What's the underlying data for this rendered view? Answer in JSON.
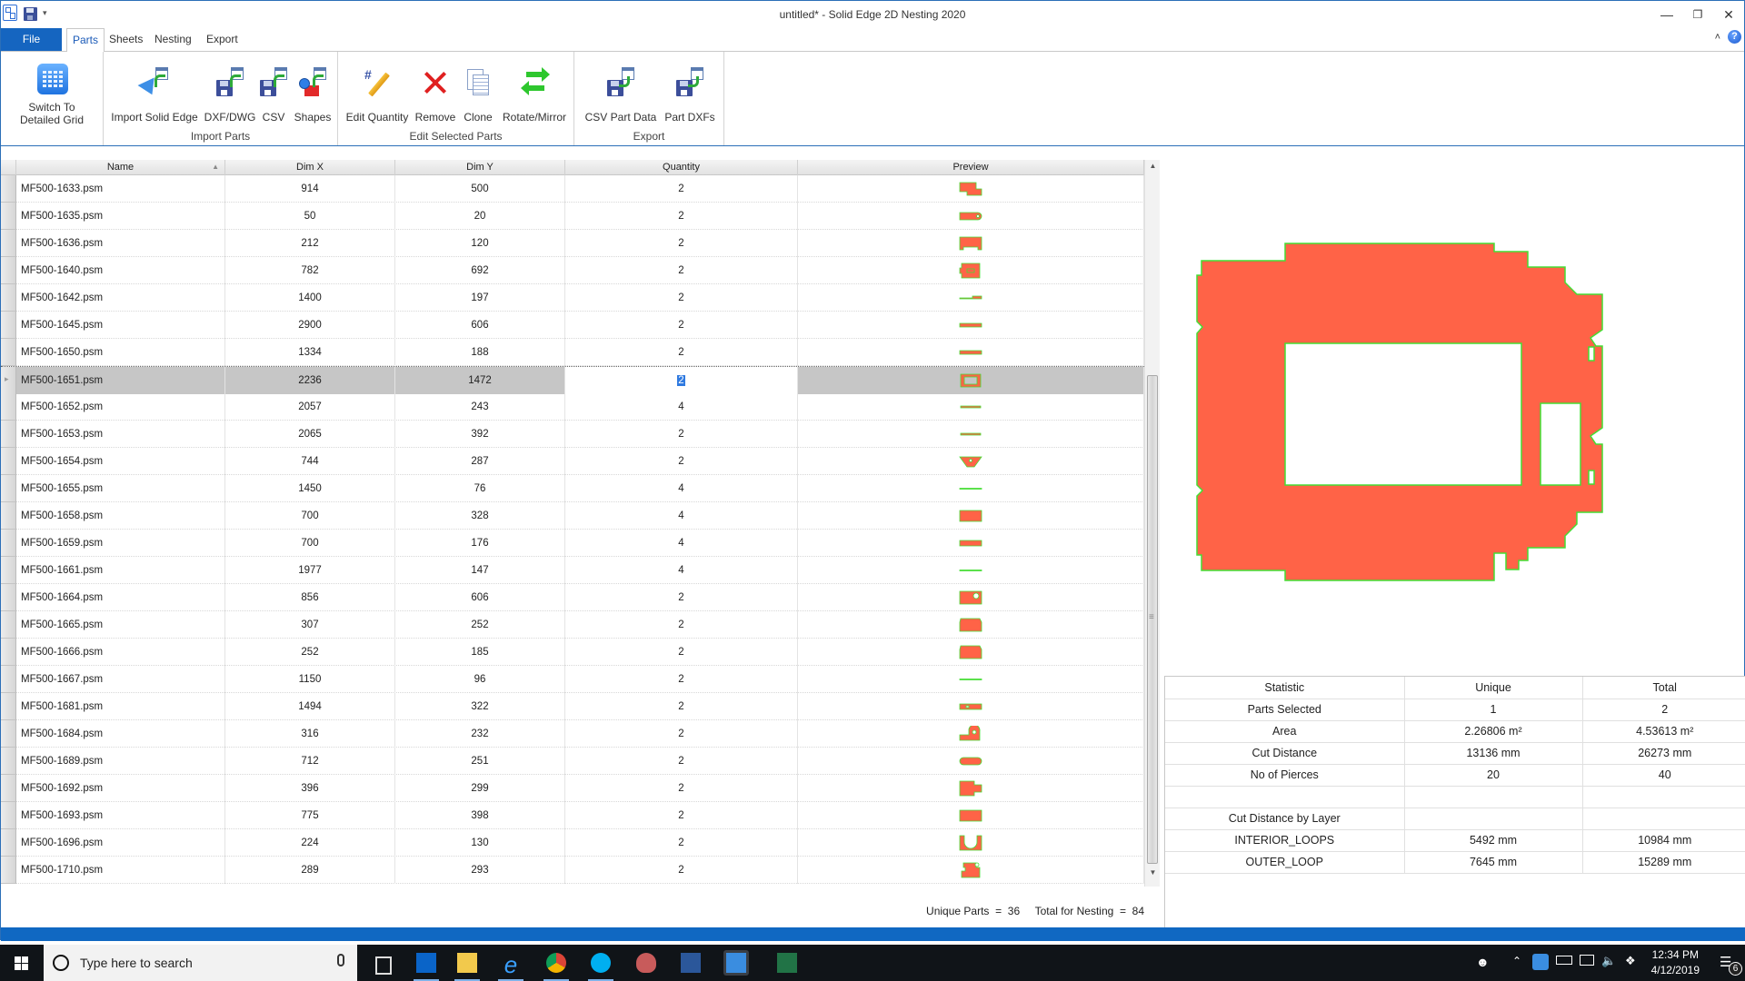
{
  "window": {
    "title": "untitled* - Solid Edge 2D Nesting 2020",
    "quick_access_dropdown": "▾",
    "controls": {
      "minimize": "—",
      "restore": "❐",
      "close": "✕"
    }
  },
  "ribbon": {
    "file_tab": "File",
    "tabs": [
      {
        "label": "Parts",
        "active": true
      },
      {
        "label": "Sheets",
        "active": false
      },
      {
        "label": "Nesting",
        "active": false
      },
      {
        "label": "Export",
        "active": false
      }
    ],
    "collapse_glyph": "˄",
    "help_glyph": "?",
    "groups": [
      {
        "label": "",
        "buttons": [
          {
            "label": "Switch To Detailed Grid",
            "icon": "grid-icon"
          }
        ]
      },
      {
        "label": "Import Parts",
        "buttons": [
          {
            "label": "Import Solid Edge",
            "icon": "import-solid-edge-icon"
          },
          {
            "label": "DXF/DWG",
            "icon": "import-dxf-icon"
          },
          {
            "label": "CSV",
            "icon": "import-csv-icon"
          },
          {
            "label": "Shapes",
            "icon": "shapes-icon"
          }
        ]
      },
      {
        "label": "Edit Selected Parts",
        "buttons": [
          {
            "label": "Edit Quantity",
            "icon": "edit-quantity-icon"
          },
          {
            "label": "Remove",
            "icon": "remove-icon"
          },
          {
            "label": "Clone",
            "icon": "clone-icon"
          },
          {
            "label": "Rotate/Mirror",
            "icon": "rotate-mirror-icon"
          }
        ]
      },
      {
        "label": "Export",
        "buttons": [
          {
            "label": "CSV Part Data",
            "icon": "export-csv-icon"
          },
          {
            "label": "Part DXFs",
            "icon": "export-dxf-icon"
          }
        ]
      }
    ]
  },
  "grid": {
    "columns": {
      "name": "Name",
      "dim_x": "Dim X",
      "dim_y": "Dim Y",
      "quantity": "Quantity",
      "preview": "Preview"
    },
    "sort_glyph": "▲",
    "selected_index": 7,
    "rows": [
      {
        "name": "MF500-1633.psm",
        "dim_x": "914",
        "dim_y": "500",
        "quantity": "2",
        "preview": "bracket-shape"
      },
      {
        "name": "MF500-1635.psm",
        "dim_x": "50",
        "dim_y": "20",
        "quantity": "2",
        "preview": "tab-hole-shape"
      },
      {
        "name": "MF500-1636.psm",
        "dim_x": "212",
        "dim_y": "120",
        "quantity": "2",
        "preview": "notched-rect-shape"
      },
      {
        "name": "MF500-1640.psm",
        "dim_x": "782",
        "dim_y": "692",
        "quantity": "2",
        "preview": "complex-panel-shape"
      },
      {
        "name": "MF500-1642.psm",
        "dim_x": "1400",
        "dim_y": "197",
        "quantity": "2",
        "preview": "thin-step-strip-shape"
      },
      {
        "name": "MF500-1645.psm",
        "dim_x": "2900",
        "dim_y": "606",
        "quantity": "2",
        "preview": "strip-shape"
      },
      {
        "name": "MF500-1650.psm",
        "dim_x": "1334",
        "dim_y": "188",
        "quantity": "2",
        "preview": "strip-shape"
      },
      {
        "name": "MF500-1651.psm",
        "dim_x": "2236",
        "dim_y": "1472",
        "quantity": "2",
        "preview": "frame-shape"
      },
      {
        "name": "MF500-1652.psm",
        "dim_x": "2057",
        "dim_y": "243",
        "quantity": "4",
        "preview": "thin-strip-shape"
      },
      {
        "name": "MF500-1653.psm",
        "dim_x": "2065",
        "dim_y": "392",
        "quantity": "2",
        "preview": "thin-strip-shape"
      },
      {
        "name": "MF500-1654.psm",
        "dim_x": "744",
        "dim_y": "287",
        "quantity": "2",
        "preview": "trapezoid-shape"
      },
      {
        "name": "MF500-1655.psm",
        "dim_x": "1450",
        "dim_y": "76",
        "quantity": "4",
        "preview": "line-shape"
      },
      {
        "name": "MF500-1658.psm",
        "dim_x": "700",
        "dim_y": "328",
        "quantity": "4",
        "preview": "rect-shape"
      },
      {
        "name": "MF500-1659.psm",
        "dim_x": "700",
        "dim_y": "176",
        "quantity": "4",
        "preview": "flat-rect-shape"
      },
      {
        "name": "MF500-1661.psm",
        "dim_x": "1977",
        "dim_y": "147",
        "quantity": "4",
        "preview": "line-shape"
      },
      {
        "name": "MF500-1664.psm",
        "dim_x": "856",
        "dim_y": "606",
        "quantity": "2",
        "preview": "rect-hole-shape"
      },
      {
        "name": "MF500-1665.psm",
        "dim_x": "307",
        "dim_y": "252",
        "quantity": "2",
        "preview": "block-shape"
      },
      {
        "name": "MF500-1666.psm",
        "dim_x": "252",
        "dim_y": "185",
        "quantity": "2",
        "preview": "block-shape"
      },
      {
        "name": "MF500-1667.psm",
        "dim_x": "1150",
        "dim_y": "96",
        "quantity": "2",
        "preview": "line-shape"
      },
      {
        "name": "MF500-1681.psm",
        "dim_x": "1494",
        "dim_y": "322",
        "quantity": "2",
        "preview": "slotted-strip-shape"
      },
      {
        "name": "MF500-1684.psm",
        "dim_x": "316",
        "dim_y": "232",
        "quantity": "2",
        "preview": "lug-shape"
      },
      {
        "name": "MF500-1689.psm",
        "dim_x": "712",
        "dim_y": "251",
        "quantity": "2",
        "preview": "rounded-strip-shape"
      },
      {
        "name": "MF500-1692.psm",
        "dim_x": "396",
        "dim_y": "299",
        "quantity": "2",
        "preview": "notched-block-shape"
      },
      {
        "name": "MF500-1693.psm",
        "dim_x": "775",
        "dim_y": "398",
        "quantity": "2",
        "preview": "rect-shape"
      },
      {
        "name": "MF500-1696.psm",
        "dim_x": "224",
        "dim_y": "130",
        "quantity": "2",
        "preview": "u-shape"
      },
      {
        "name": "MF500-1710.psm",
        "dim_x": "289",
        "dim_y": "293",
        "quantity": "2",
        "preview": "bracket-hole-shape"
      }
    ],
    "footer": {
      "unique_label": "Unique Parts  =",
      "unique_value": "36",
      "total_label": "Total for Nesting  =",
      "total_value": "84"
    },
    "scroll": {
      "up": "▲",
      "down": "▼"
    }
  },
  "preview": {
    "part_name": "MF500-1651.psm",
    "fill_color": "#ff6347",
    "outline_color": "#44dd33"
  },
  "statistics": {
    "headers": [
      "Statistic",
      "Unique",
      "Total"
    ],
    "rows": [
      [
        "Parts Selected",
        "1",
        "2"
      ],
      [
        "Area",
        "2.26806 m²",
        "4.53613 m²"
      ],
      [
        "Cut Distance",
        "13136 mm",
        "26273 mm"
      ],
      [
        "No of Pierces",
        "20",
        "40"
      ],
      [
        "",
        "",
        ""
      ],
      [
        "Cut Distance by Layer",
        "",
        ""
      ],
      [
        "INTERIOR_LOOPS",
        "5492 mm",
        "10984 mm"
      ],
      [
        "OUTER_LOOP",
        "7645 mm",
        "15289 mm"
      ]
    ]
  },
  "taskbar": {
    "search_placeholder": "Type here to search",
    "apps": [
      "task-view",
      "outlook",
      "file-explorer",
      "internet-explorer",
      "chrome",
      "skype",
      "snipping-tool",
      "word",
      "solid-edge-nesting",
      "excel"
    ],
    "clock_time": "12:34 PM",
    "clock_date": "4/12/2019",
    "notification_count": "6"
  },
  "colors": {
    "accent": "#1565c0",
    "part_fill": "#ff6347",
    "part_outline": "#44dd33",
    "selection": "#c6c6c6"
  }
}
